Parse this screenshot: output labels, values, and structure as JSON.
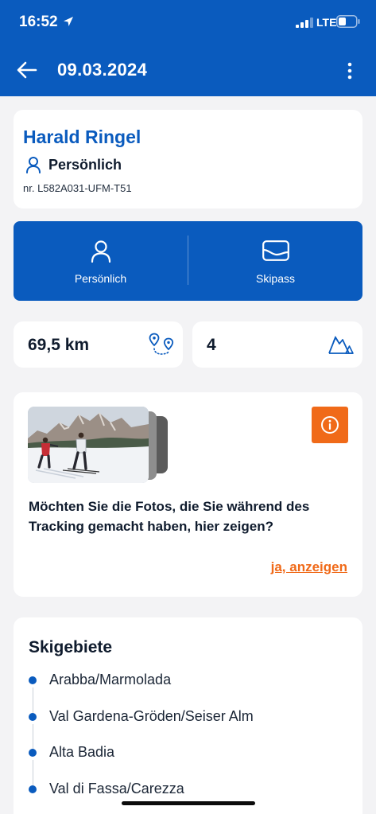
{
  "status_bar": {
    "time": "16:52",
    "network": "LTE"
  },
  "header": {
    "title": "09.03.2024"
  },
  "user": {
    "name": "Harald Ringel",
    "type": "Persönlich",
    "number": "nr. L582A031-UFM-T51"
  },
  "tabs": [
    {
      "label": "Persönlich"
    },
    {
      "label": "Skipass"
    }
  ],
  "stats": {
    "distance": "69,5 km",
    "count": "4"
  },
  "photos": {
    "question": "Möchten Sie die Fotos, die Sie während des Tracking gemacht haben, hier zeigen?",
    "link": "ja, anzeigen"
  },
  "ski_areas": {
    "title": "Skigebiete",
    "items": [
      {
        "label": "Arabba/Marmolada"
      },
      {
        "label": "Val Gardena-Gröden/Seiser Alm"
      },
      {
        "label": "Alta Badia"
      },
      {
        "label": "Val di Fassa/Carezza"
      }
    ]
  },
  "colors": {
    "primary": "#0a5bbe",
    "accent": "#f06a19",
    "background": "#f3f3f5"
  }
}
